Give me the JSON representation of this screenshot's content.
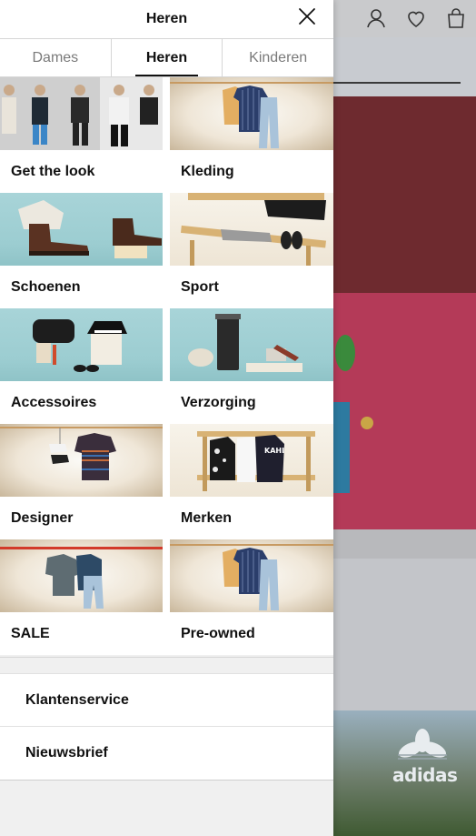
{
  "drawer": {
    "title": "Heren",
    "tabs": [
      {
        "label": "Dames"
      },
      {
        "label": "Heren"
      },
      {
        "label": "Kinderen"
      }
    ],
    "categories": [
      {
        "label": "Get the look",
        "image": "group-of-men-photo"
      },
      {
        "label": "Kleding",
        "image": "shirt-and-jeans-photo"
      },
      {
        "label": "Schoenen",
        "image": "boots-photo"
      },
      {
        "label": "Sport",
        "image": "bench-sneakers-photo"
      },
      {
        "label": "Accessoires",
        "image": "bag-hat-sunglasses-photo"
      },
      {
        "label": "Verzorging",
        "image": "grooming-products-photo"
      },
      {
        "label": "Designer",
        "image": "sweater-sneakers-photo"
      },
      {
        "label": "Merken",
        "image": "jackets-on-bench-photo"
      },
      {
        "label": "SALE",
        "image": "sweater-and-jeans-photo"
      },
      {
        "label": "Pre-owned",
        "image": "shirt-and-jeans-photo"
      }
    ],
    "links": [
      {
        "label": "Klantenservice"
      },
      {
        "label": "Nieuwsbrief"
      }
    ]
  },
  "background": {
    "brand_logo_text": "adidas"
  }
}
